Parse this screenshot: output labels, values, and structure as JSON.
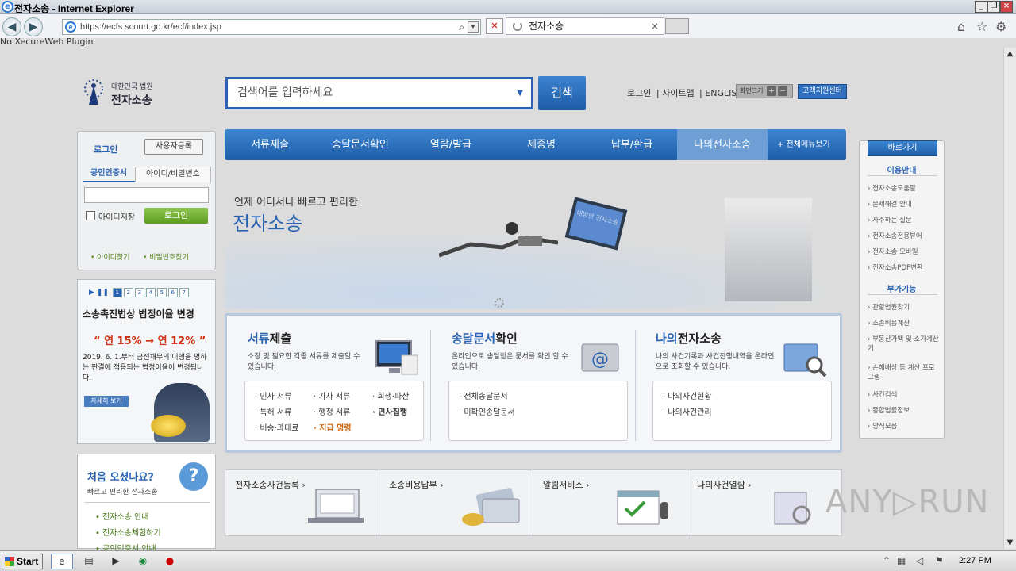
{
  "window": {
    "title": "전자소송 - Internet Explorer",
    "url": "https://ecfs.scourt.go.kr/ecf/index.jsp",
    "tab_title": "전자소송",
    "plugin_msg": "No XecureWeb Plugin"
  },
  "logo": {
    "line1": "대한민국 법원",
    "line2": "전자소송"
  },
  "search": {
    "placeholder": "검색어를 입력하세요",
    "button": "검색"
  },
  "toplinks": {
    "login": "로그인",
    "sitemap": "사이트맵",
    "english": "ENGLISH",
    "font_label": "화면크기",
    "plus": "+",
    "minus": "−",
    "help": "고객지원센터"
  },
  "login": {
    "title": "로그인",
    "register": "사용자등록",
    "tab_cert": "공인인증서",
    "tab_id": "아이디/비밀번호",
    "save_id": "아이디저장",
    "login_btn": "로그인",
    "find_id": "• 아이디찾기",
    "find_pw": "• 비밀번호찾기"
  },
  "notice": {
    "pages": [
      "1",
      "2",
      "3",
      "4",
      "5",
      "6",
      "7"
    ],
    "title": "소송촉진법상 법정이율 변경",
    "rate": "“ 연 15% → 연 12% ”",
    "desc": "2019. 6. 1.부터 금전채무의 이행을 명하는 판결에 적용되는 법정이율이 변경됩니다.",
    "more": "자세히 보기"
  },
  "first": {
    "title": "처음 오셨나요?",
    "sub": "빠르고 편리한 전자소송",
    "items": [
      "• 전자소송 안내",
      "• 전자소송체험하기",
      "• 공인인증서 안내"
    ]
  },
  "nav": {
    "items": [
      "서류제출",
      "송달문서확인",
      "열람/발급",
      "제증명",
      "납부/환급",
      "나의전자소송"
    ],
    "all": "+ 전체메뉴보기"
  },
  "hero": {
    "sub": "언제 어디서나 빠르고 편리한",
    "title": "전자소송",
    "monitor": "내방안 전자소송"
  },
  "services": [
    {
      "h1": "서류",
      "h2": "제출",
      "desc": "소장 및 필요한 각종 서류를 제출할 수 있습니다.",
      "items": [
        "· 민사 서류",
        "· 가사 서류",
        "· 회생·파산",
        "· 특허 서류",
        "· 행정 서류",
        "· 민사집행",
        "· 비송·과태료",
        "· 지급 명령"
      ]
    },
    {
      "h1": "송달문서",
      "h2": "확인",
      "desc": "온라인으로 송달받은 문서를 확인 할 수 있습니다.",
      "items": [
        "· 전체송달문서",
        "· 미확인송달문서"
      ]
    },
    {
      "h1": "나의",
      "h2": "전자소송",
      "desc": "나의 사건기록과 사건진행내역을 온라인으로 조회할 수 있습니다.",
      "items": [
        "· 나의사건현황",
        "· 나의사건관리"
      ]
    }
  ],
  "tiles": [
    "전자소송사건등록  ›",
    "소송비용납부  ›",
    "알림서비스  ›",
    "나의사건열람  ›"
  ],
  "quick": {
    "title": "바로가기",
    "sec1": "이용안내",
    "items1": [
      "› 전자소송도움말",
      "› 문제해결 안내",
      "› 자주하는 질문",
      "› 전자소송전용뷰어",
      "› 전자소송 모바일",
      "› 전자소송PDF변환"
    ],
    "sec2": "부가기능",
    "items2": [
      "› 관할법원찾기",
      "› 소송비용계산",
      "› 부동산가액 및 소가계산기",
      "› 손해배상 등 계산 프로그램",
      "› 사건검색",
      "› 종합법률정보",
      "› 양식모음"
    ]
  },
  "watermark": "ANY▷RUN",
  "taskbar": {
    "start": "Start",
    "clock": "2:27 PM"
  }
}
